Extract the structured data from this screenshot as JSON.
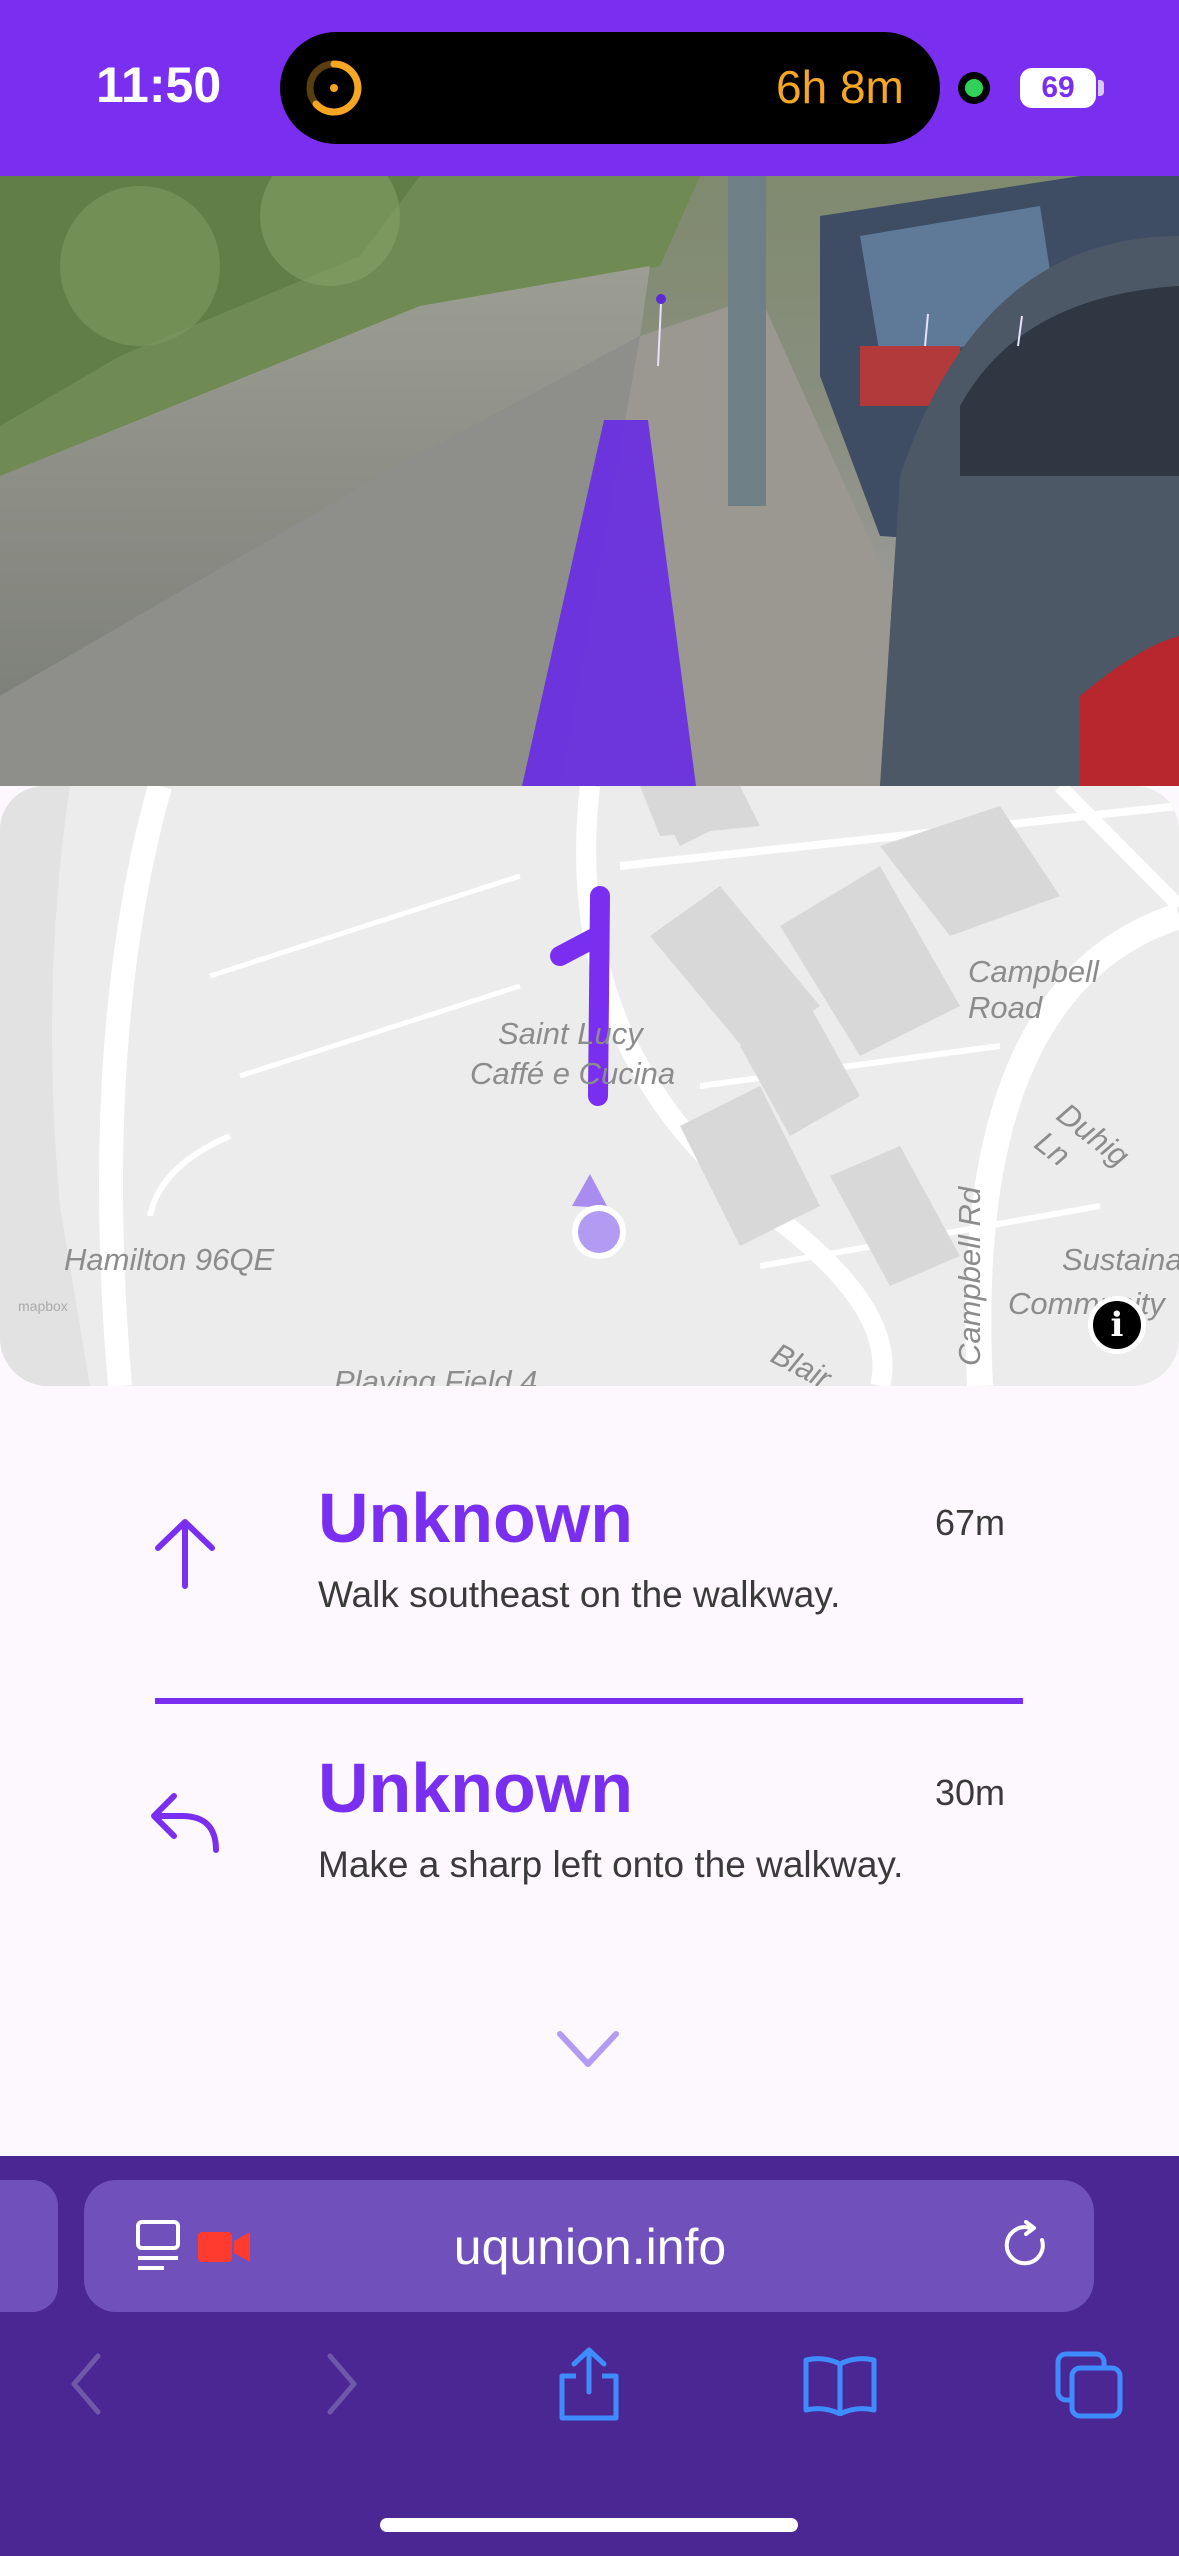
{
  "status_bar": {
    "time": "11:50",
    "live_activity_timer": "6h 8m",
    "battery": "69"
  },
  "map": {
    "labels": [
      "Campbell Road",
      "Saint Lucy",
      "Caffé e Cucina",
      "Duhig Ln",
      "Hamilton 96QE",
      "Sustaina",
      "Community",
      "Campbell Rd",
      "Blair",
      "Playing Field 4"
    ],
    "route_number": "1",
    "attribution": "mapbox"
  },
  "steps": [
    {
      "icon": "arrow-up-icon",
      "street": "Unknown",
      "distance": "67m",
      "description": "Walk southeast on the walkway."
    },
    {
      "icon": "sharp-left-arrow-icon",
      "street": "Unknown",
      "distance": "30m",
      "description": "Make a sharp left onto the walkway."
    }
  ],
  "browser": {
    "url": "uqunion.info"
  },
  "colors": {
    "accent": "#7a2ff0",
    "browser_bar": "#4b2793",
    "url_field": "#7050bb",
    "timer_orange": "#f5a623"
  }
}
